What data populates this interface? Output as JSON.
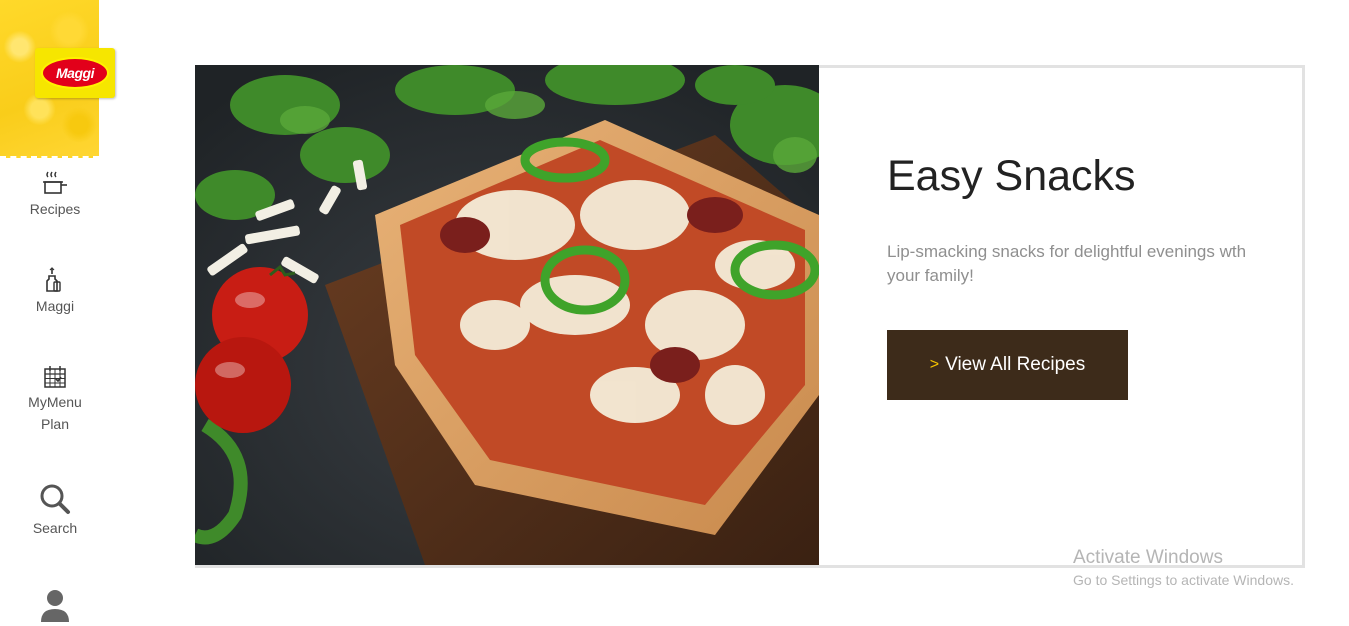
{
  "brand": {
    "logo_text": "Maggi"
  },
  "sidebar": {
    "items": [
      {
        "label": "Recipes",
        "icon": "cooking-pot-icon"
      },
      {
        "label": "Maggi",
        "icon": "maggi-bottle-icon"
      },
      {
        "label": "MyMenu",
        "label2": "Plan",
        "icon": "calendar-icon"
      },
      {
        "label": "Search",
        "icon": "search-icon"
      },
      {
        "label": "",
        "icon": "user-icon"
      }
    ]
  },
  "banner": {
    "title": "Easy Snacks",
    "subtitle": "Lip-smacking snacks for delightful evenings wth your family!",
    "cta_label": "View All Recipes",
    "cta_chevron": ">",
    "image": "pizza-toast-image"
  },
  "watermark": {
    "title": "Activate Windows",
    "subtitle": "Go to Settings to activate Windows."
  },
  "colors": {
    "brand_yellow": "#ffd92a",
    "brand_red": "#e2001a",
    "cta_bg": "#3d2b1a",
    "cta_chevron": "#f5c400"
  }
}
